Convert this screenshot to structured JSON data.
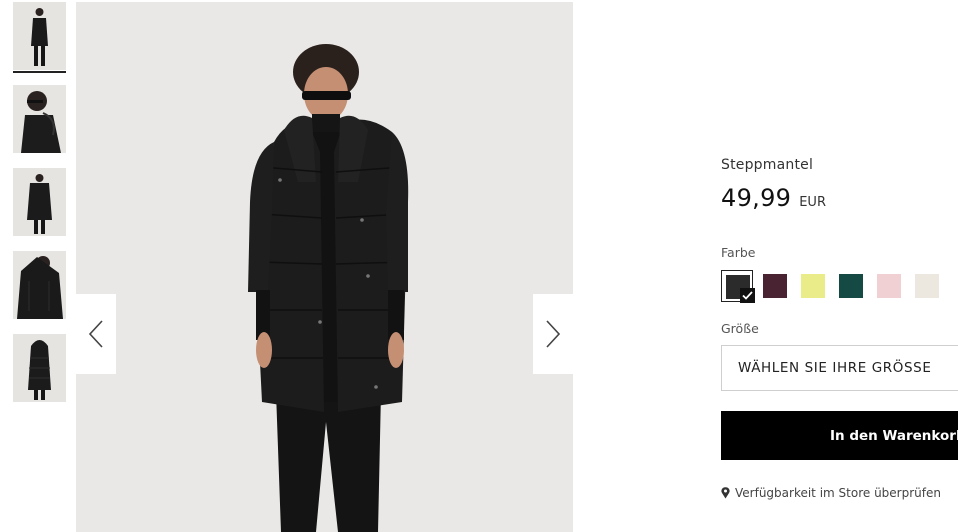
{
  "thumbnails": [
    {
      "name": "front-full"
    },
    {
      "name": "side-closeup"
    },
    {
      "name": "front-open"
    },
    {
      "name": "hood-closeup"
    },
    {
      "name": "back-view"
    }
  ],
  "gallery": {
    "prev_icon": "chevron-left-icon",
    "next_icon": "chevron-right-icon"
  },
  "product": {
    "name": "Steppmantel",
    "price": "49,99",
    "currency": "EUR"
  },
  "color": {
    "label": "Farbe",
    "swatches": [
      {
        "color": "#2b2b2b",
        "selected": true
      },
      {
        "color": "#4a2332",
        "selected": false
      },
      {
        "color": "#eaec8a",
        "selected": false
      },
      {
        "color": "#154a44",
        "selected": false
      },
      {
        "color": "#f1d0d3",
        "selected": false
      },
      {
        "color": "#ece7df",
        "selected": false
      }
    ]
  },
  "size": {
    "label": "Größe",
    "placeholder": "WÄHLEN SIE IHRE GRÖSSE"
  },
  "cart": {
    "label": "In den Warenkorb",
    "icon": "shopping-bag-icon"
  },
  "store": {
    "label": "Verfügbarkeit im Store überprüfen",
    "icon": "map-pin-icon"
  }
}
